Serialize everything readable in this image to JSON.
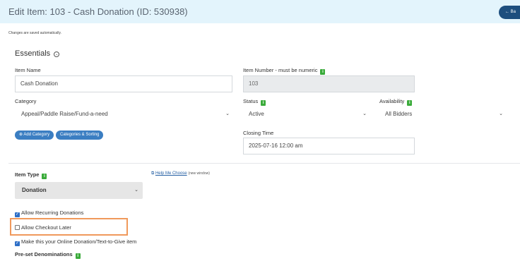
{
  "header": {
    "title": "Edit Item: 103 - Cash Donation (ID: 530938)",
    "back_label": "← Ba"
  },
  "autosave_note": "Changes are saved automatically.",
  "essentials": {
    "title": "Essentials",
    "item_name": {
      "label": "Item Name",
      "value": "Cash Donation"
    },
    "item_number": {
      "label": "Item Number - must be numeric",
      "value": "103"
    },
    "category": {
      "label": "Category",
      "value": "Appeal/Paddle Raise/Fund-a-need"
    },
    "status": {
      "label": "Status",
      "value": "Active"
    },
    "availability": {
      "label": "Availability",
      "value": "All Bidders"
    },
    "closing_time": {
      "label": "Closing Time",
      "value": "2025-07-16 12:00 am"
    },
    "add_category": "Add Category",
    "categories_sorting": "Categories & Sorting"
  },
  "item_type": {
    "label": "Item Type",
    "value": "Donation",
    "help_link": "Help Me Choose",
    "help_note": "(new window)"
  },
  "options": [
    {
      "label": "Allow Recurring Donations",
      "checked": true
    },
    {
      "label": "Allow Checkout Later",
      "checked": false
    },
    {
      "label": "Make this your Online Donation/Text-to-Give item",
      "checked": true
    }
  ],
  "preset_label": "Pre-set Denominations",
  "colors": {
    "header_bg": "#e3f4fc",
    "accent": "#3b7ec2",
    "info_badge": "#3aab3a",
    "highlight": "#f0995b"
  },
  "icons": {
    "info": "info-icon",
    "caret": "chevron-down-icon",
    "external": "external-link-icon"
  }
}
